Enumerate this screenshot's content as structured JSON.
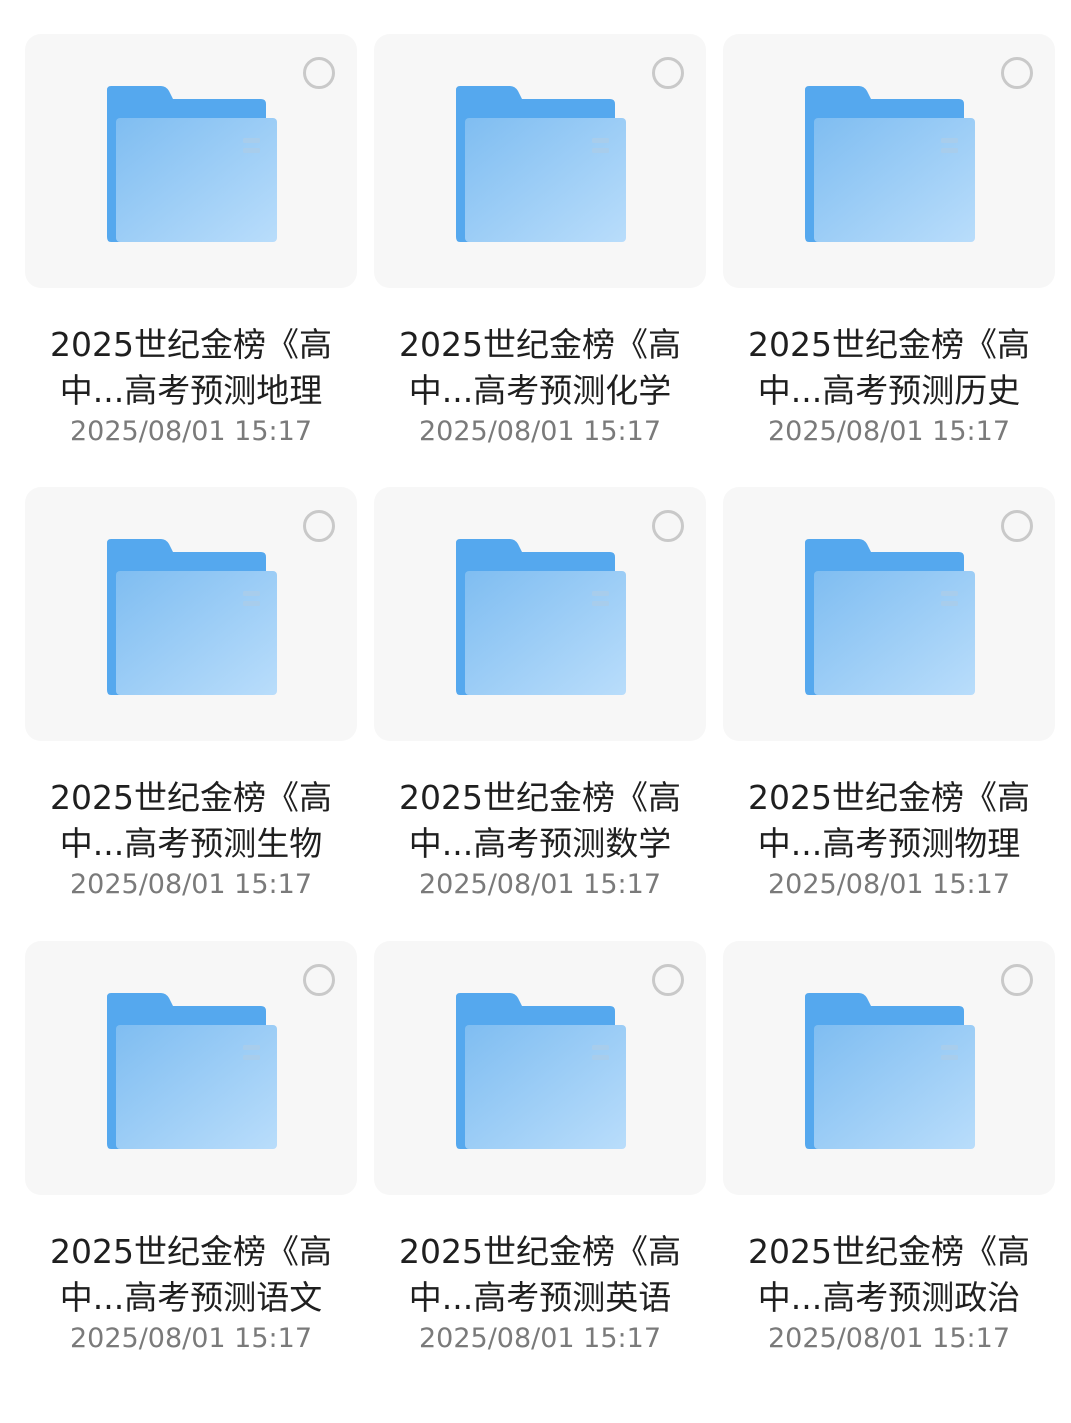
{
  "files": [
    {
      "name_line1": "2025世纪金榜《高",
      "name_line2": "中...高考预测地理",
      "date": "2025/08/01 15:17"
    },
    {
      "name_line1": "2025世纪金榜《高",
      "name_line2": "中...高考预测化学",
      "date": "2025/08/01 15:17"
    },
    {
      "name_line1": "2025世纪金榜《高",
      "name_line2": "中...高考预测历史",
      "date": "2025/08/01 15:17"
    },
    {
      "name_line1": "2025世纪金榜《高",
      "name_line2": "中...高考预测生物",
      "date": "2025/08/01 15:17"
    },
    {
      "name_line1": "2025世纪金榜《高",
      "name_line2": "中...高考预测数学",
      "date": "2025/08/01 15:17"
    },
    {
      "name_line1": "2025世纪金榜《高",
      "name_line2": "中...高考预测物理",
      "date": "2025/08/01 15:17"
    },
    {
      "name_line1": "2025世纪金榜《高",
      "name_line2": "中...高考预测语文",
      "date": "2025/08/01 15:17"
    },
    {
      "name_line1": "2025世纪金榜《高",
      "name_line2": "中...高考预测英语",
      "date": "2025/08/01 15:17"
    },
    {
      "name_line1": "2025世纪金榜《高",
      "name_line2": "中...高考预测政治",
      "date": "2025/08/01 15:17"
    }
  ],
  "icons": {
    "folder": "folder-icon",
    "select": "select-circle-icon"
  },
  "colors": {
    "folder_back": "#5aabef",
    "folder_front_start": "#82bff2",
    "folder_front_end": "#b7dcfb",
    "tile_background": "#f7f7f7",
    "select_border": "#c9c9c9"
  }
}
